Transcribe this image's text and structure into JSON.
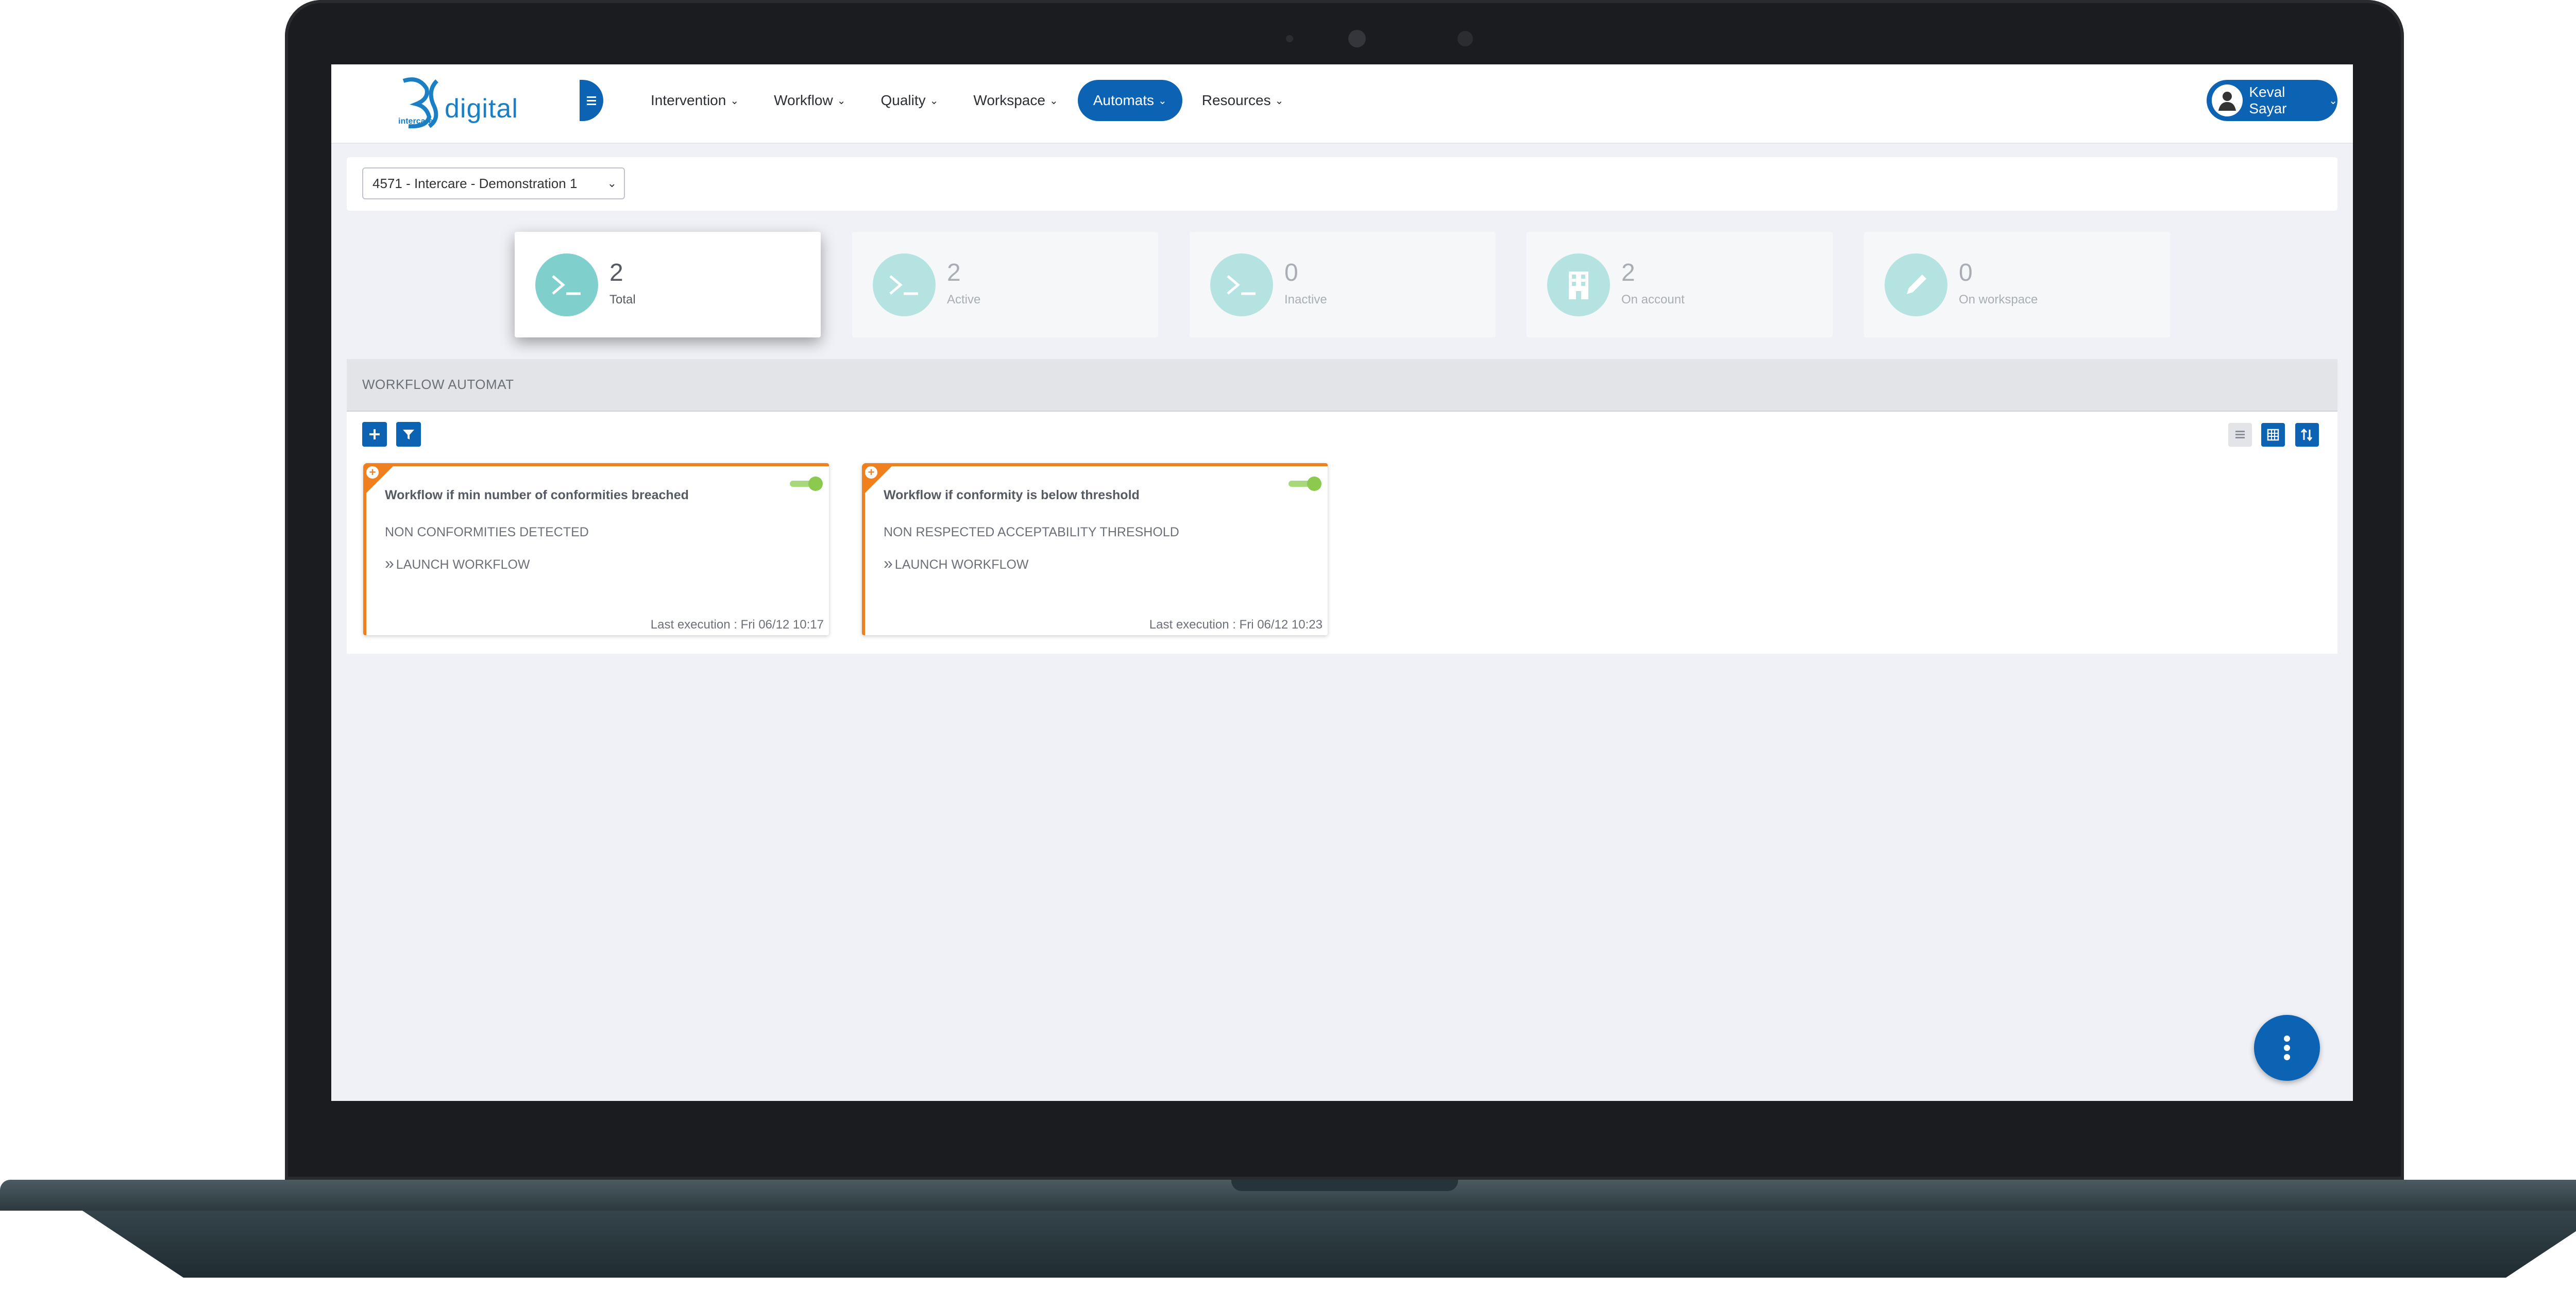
{
  "header": {
    "logo_text": "digital",
    "logo_sub": "intercare",
    "nav": [
      {
        "label": "Intervention"
      },
      {
        "label": "Workflow"
      },
      {
        "label": "Quality"
      },
      {
        "label": "Workspace"
      },
      {
        "label": "Automats",
        "active": true
      },
      {
        "label": "Resources"
      }
    ],
    "user_name": "Keval Sayar"
  },
  "account": {
    "selected": "4571 - Intercare - Demonstration 1"
  },
  "stats": [
    {
      "value": "2",
      "label": "Total",
      "selected": true,
      "icon": "terminal-icon"
    },
    {
      "value": "2",
      "label": "Active",
      "icon": "terminal-icon"
    },
    {
      "value": "0",
      "label": "Inactive",
      "icon": "terminal-icon"
    },
    {
      "value": "2",
      "label": "On account",
      "icon": "building-icon"
    },
    {
      "value": "0",
      "label": "On workspace",
      "icon": "pencil-icon"
    }
  ],
  "panel": {
    "title": "WORKFLOW AUTOMAT",
    "cards": [
      {
        "title": "Workflow if min number of conformities breached",
        "condition": "NON CONFORMITIES DETECTED",
        "action": "LAUNCH WORKFLOW",
        "last_execution": "Last execution : Fri 06/12 10:17",
        "enabled": true
      },
      {
        "title": "Workflow if conformity is below threshold",
        "condition": "NON RESPECTED ACCEPTABILITY THRESHOLD",
        "action": "LAUNCH WORKFLOW",
        "last_execution": "Last execution : Fri 06/12 10:23",
        "enabled": true
      }
    ]
  },
  "colors": {
    "primary": "#0d63b3",
    "accent_orange": "#f07f1e",
    "teal": "#7fcfcc",
    "toggle_on": "#8bc94f"
  }
}
